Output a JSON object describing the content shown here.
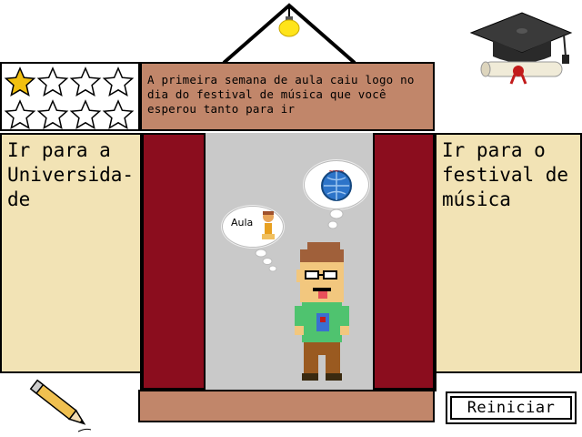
{
  "stars": {
    "filled": 1,
    "total": 8
  },
  "story": {
    "text": "A primeira semana de aula caiu logo no dia do festival de música que você esperou tanto para ir"
  },
  "choices": {
    "left": "Ir para a\nUniversida-\nde",
    "right": "Ir para o\nfestival de\nmúsica"
  },
  "bubbles": {
    "class_label": "Aula"
  },
  "restart_label": "Reiniciar",
  "colors": {
    "curtain": "#8b0d1e",
    "wood": "#c1866a",
    "panel": "#f2e3b5",
    "wall": "#c9c9c9",
    "star": "#f2c010"
  },
  "icons": [
    "star-icon",
    "graduation-cap-icon",
    "diploma-icon",
    "pencil-icon",
    "lamp-icon",
    "globe-icon",
    "student-icon"
  ]
}
